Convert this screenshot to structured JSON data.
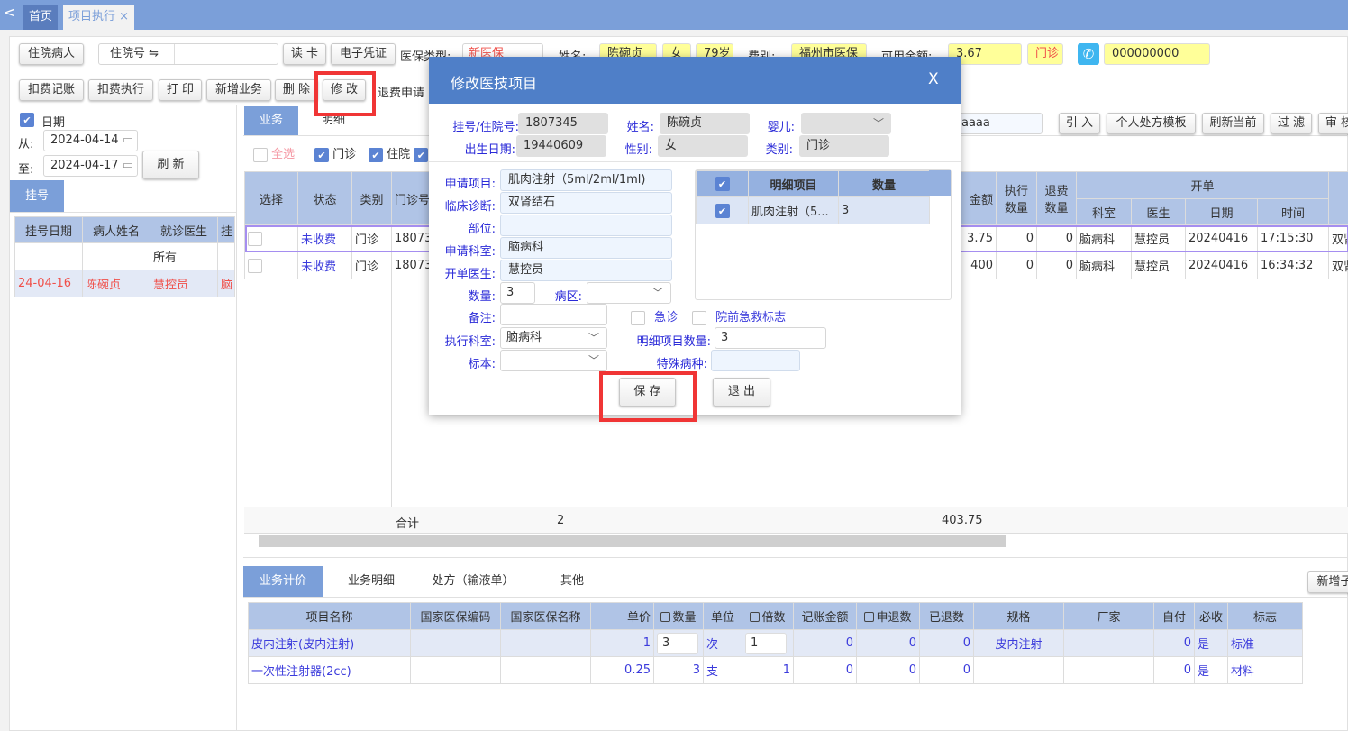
{
  "tabs": {
    "back": "<",
    "home": "首页",
    "current": "项目执行",
    "close": "×"
  },
  "toolbar1": {
    "inpatient_btn": "住院病人",
    "admission_label": "住院号 ⇋",
    "admission_value": "",
    "read_card": "读 卡",
    "e_voucher": "电子凭证",
    "insurance_label": "医保类型:",
    "insurance_value": "新医保",
    "name_label": "姓名:",
    "name_value": "陈碗贞",
    "gender_value": "女",
    "age_value": "79岁",
    "fee_label": "费别:",
    "fee_value": "福州市医保",
    "balance_label": "可用余额:",
    "balance_value": "3.67",
    "visit_type": "门诊",
    "phone": "000000000"
  },
  "toolbar2": [
    "扣费记账",
    "扣费执行",
    "打 印",
    "新增业务",
    "删 除",
    "修 改",
    "退费申请"
  ],
  "left": {
    "date_check_label": "日期",
    "from_label": "从:",
    "from_value": "2024-04-14",
    "to_label": "至:",
    "to_value": "2024-04-17",
    "refresh": "刷 新",
    "tab": "挂号",
    "columns": [
      "挂号日期",
      "病人姓名",
      "就诊医生",
      "挂"
    ],
    "rows": [
      [
        "",
        "",
        "所有",
        ""
      ],
      [
        "24-04-16",
        "陈碗贞",
        "慧控员",
        "脑"
      ]
    ]
  },
  "main": {
    "tabs": [
      "业务",
      "明细"
    ],
    "search_value": "aaaa",
    "buttons": [
      "引 入",
      "个人处方模板",
      "刷新当前",
      "过 滤",
      "审 核"
    ],
    "filters": {
      "select_all": "全选",
      "outpatient": "门诊",
      "inpatient": "住院"
    },
    "columns_left": [
      "选择",
      "状态",
      "类别",
      "门诊号"
    ],
    "columns_right": [
      "金额",
      "执行数量",
      "退费数量"
    ],
    "group_header": "开单",
    "sub_columns": [
      "科室",
      "医生",
      "日期",
      "时间"
    ],
    "rows": [
      {
        "status": "未收费",
        "type": "门诊",
        "no": "18073",
        "amount": "3.75",
        "exec": "0",
        "refund": "0",
        "dept": "脑病科",
        "doctor": "慧控员",
        "date": "20240416",
        "time": "17:15:30",
        "extra": "双肾"
      },
      {
        "status": "未收费",
        "type": "门诊",
        "no": "18073",
        "amount": "400",
        "exec": "0",
        "refund": "0",
        "dept": "脑病科",
        "doctor": "慧控员",
        "date": "20240416",
        "time": "16:34:32",
        "extra": "双肾"
      }
    ],
    "total_label": "合计",
    "total_count": "2",
    "total_amount": "403.75"
  },
  "bottom": {
    "tabs": [
      "业务计价",
      "业务明细",
      "处方（输液单）",
      "其他"
    ],
    "add_btn": "新增子",
    "columns": [
      "项目名称",
      "国家医保编码",
      "国家医保名称",
      "单价",
      "数量",
      "单位",
      "倍数",
      "记账金额",
      "申退数",
      "已退数",
      "规格",
      "厂家",
      "自付",
      "必收",
      "标志"
    ],
    "rows": [
      [
        "皮内注射(皮内注射)",
        "",
        "",
        "1",
        "3",
        "次",
        "1",
        "0",
        "0",
        "0",
        "皮内注射",
        "",
        "0",
        "是",
        "标准"
      ],
      [
        "一次性注射器(2cc)",
        "",
        "",
        "0.25",
        "3",
        "支",
        "1",
        "0",
        "0",
        "0",
        "",
        "",
        "0",
        "是",
        "材料"
      ]
    ]
  },
  "modal": {
    "title": "修改医技项目",
    "close": "X",
    "reg_label": "挂号/住院号:",
    "reg_value": "1807345",
    "name_label": "姓名:",
    "name_value": "陈碗贞",
    "baby_label": "婴儿:",
    "baby_value": "",
    "dob_label": "出生日期:",
    "dob_value": "19440609",
    "gender_label": "性别:",
    "gender_value": "女",
    "type_label": "类别:",
    "type_value": "门诊",
    "item_label": "申请项目:",
    "item_value": "肌肉注射（5ml/2ml/1ml)",
    "diag_label": "临床诊断:",
    "diag_value": "双肾结石",
    "site_label": "部位:",
    "site_value": "",
    "dept_label": "申请科室:",
    "dept_value": "脑病科",
    "doctor_label": "开单医生:",
    "doctor_value": "慧控员",
    "qty_label": "数量:",
    "qty_value": "3",
    "ward_label": "病区:",
    "ward_value": "",
    "note_label": "备注:",
    "note_value": "",
    "emergency_label": "急诊",
    "prehospital_label": "院前急救标志",
    "exec_dept_label": "执行科室:",
    "exec_dept_value": "脑病科",
    "detail_qty_label": "明细项目数量:",
    "detail_qty_value": "3",
    "specimen_label": "标本:",
    "specimen_value": "",
    "special_label": "特殊病种:",
    "special_value": "",
    "detail_columns": [
      "明细项目",
      "数量"
    ],
    "detail_rows": [
      {
        "item": "肌肉注射（5...",
        "qty": "3"
      }
    ],
    "save": "保 存",
    "exit": "退 出"
  },
  "colors": {
    "accent": "#4f7fc8",
    "tab_bar": "#7b9fd9",
    "header": "#b0c4e6",
    "highlight": "#f03535"
  }
}
